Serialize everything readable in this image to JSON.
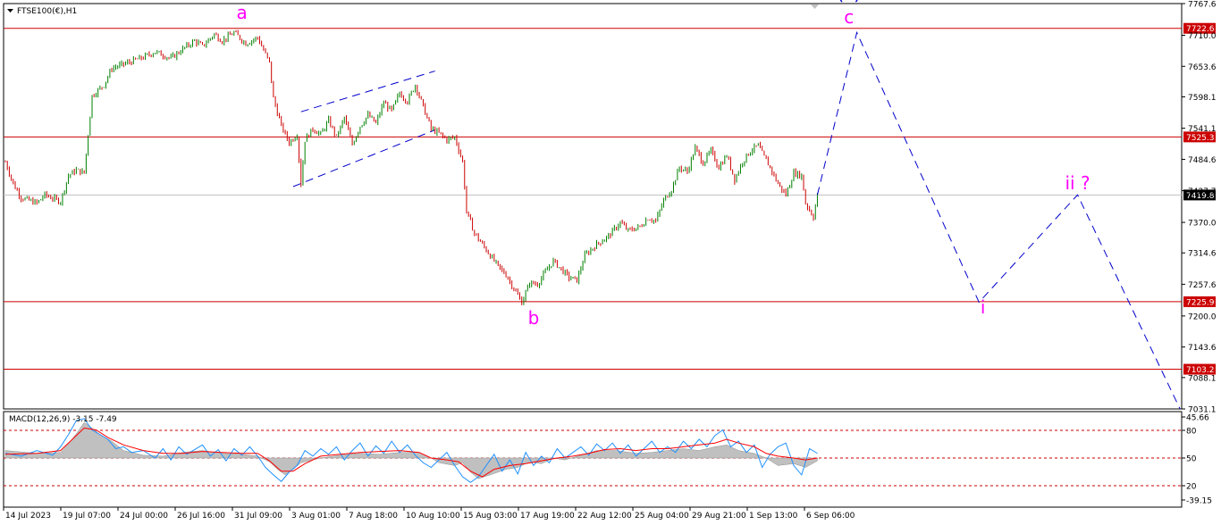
{
  "chart_data": [
    {
      "type": "candlestick",
      "symbol_label": "FTSE100(€),H1",
      "ylim": [
        7031.1,
        7767.6
      ],
      "y_ticks": [
        "7767.6",
        "7710.0",
        "7653.6",
        "7598.1",
        "7541.1",
        "7484.6",
        "7427.7",
        "7370.0",
        "7314.6",
        "7257.6",
        "7200.0",
        "7143.6",
        "7088.1",
        "7031.1"
      ],
      "x_ticks": [
        "14 Jul 2023",
        "19 Jul 07:00",
        "24 Jul 00:00",
        "26 Jul 16:00",
        "31 Jul 09:00",
        "3 Aug 01:00",
        "7 Aug 18:00",
        "10 Aug 10:00",
        "15 Aug 03:00",
        "17 Aug 19:00",
        "22 Aug 12:00",
        "25 Aug 04:00",
        "29 Aug 21:00",
        "1 Sep 13:00",
        "6 Sep 06:00"
      ],
      "current_price": "7419.8",
      "horizontal_levels": [
        {
          "value": 7722.6,
          "label": "7722.6"
        },
        {
          "value": 7525.3,
          "label": "7525.3"
        },
        {
          "value": 7225.9,
          "label": "7225.9"
        },
        {
          "value": 7103.2,
          "label": "7103.2"
        }
      ],
      "price_path": [
        [
          0,
          7480
        ],
        [
          2,
          7440
        ],
        [
          4,
          7415
        ],
        [
          8,
          7405
        ],
        [
          10,
          7420
        ],
        [
          14,
          7408
        ],
        [
          16,
          7455
        ],
        [
          18,
          7465
        ],
        [
          20,
          7460
        ],
        [
          21,
          7530
        ],
        [
          22,
          7600
        ],
        [
          25,
          7620
        ],
        [
          27,
          7650
        ],
        [
          31,
          7660
        ],
        [
          35,
          7670
        ],
        [
          38,
          7680
        ],
        [
          42,
          7668
        ],
        [
          45,
          7685
        ],
        [
          48,
          7700
        ],
        [
          50,
          7690
        ],
        [
          53,
          7712
        ],
        [
          55,
          7700
        ],
        [
          58,
          7715
        ],
        [
          61,
          7695
        ],
        [
          64,
          7706
        ],
        [
          67,
          7660
        ],
        [
          68,
          7595
        ],
        [
          70,
          7545
        ],
        [
          72,
          7515
        ],
        [
          74,
          7530
        ],
        [
          75,
          7440
        ],
        [
          76,
          7520
        ],
        [
          78,
          7540
        ],
        [
          80,
          7530
        ],
        [
          82,
          7555
        ],
        [
          84,
          7525
        ],
        [
          86,
          7560
        ],
        [
          88,
          7512
        ],
        [
          90,
          7545
        ],
        [
          92,
          7565
        ],
        [
          94,
          7550
        ],
        [
          96,
          7588
        ],
        [
          98,
          7572
        ],
        [
          100,
          7605
        ],
        [
          102,
          7590
        ],
        [
          104,
          7620
        ],
        [
          106,
          7580
        ],
        [
          108,
          7540
        ],
        [
          110,
          7532
        ],
        [
          112,
          7520
        ],
        [
          114,
          7525
        ],
        [
          116,
          7480
        ],
        [
          117,
          7390
        ],
        [
          119,
          7350
        ],
        [
          121,
          7330
        ],
        [
          123,
          7310
        ],
        [
          125,
          7290
        ],
        [
          127,
          7275
        ],
        [
          129,
          7250
        ],
        [
          131,
          7225
        ],
        [
          133,
          7260
        ],
        [
          135,
          7258
        ],
        [
          137,
          7280
        ],
        [
          139,
          7300
        ],
        [
          141,
          7285
        ],
        [
          143,
          7270
        ],
        [
          145,
          7265
        ],
        [
          147,
          7310
        ],
        [
          150,
          7330
        ],
        [
          153,
          7345
        ],
        [
          156,
          7370
        ],
        [
          158,
          7355
        ],
        [
          161,
          7362
        ],
        [
          163,
          7378
        ],
        [
          165,
          7372
        ],
        [
          167,
          7410
        ],
        [
          169,
          7430
        ],
        [
          171,
          7470
        ],
        [
          173,
          7462
        ],
        [
          175,
          7505
        ],
        [
          177,
          7478
        ],
        [
          179,
          7500
        ],
        [
          181,
          7470
        ],
        [
          183,
          7492
        ],
        [
          185,
          7448
        ],
        [
          187,
          7480
        ],
        [
          189,
          7500
        ],
        [
          191,
          7510
        ],
        [
          192,
          7495
        ],
        [
          194,
          7470
        ],
        [
          196,
          7440
        ],
        [
          198,
          7420
        ],
        [
          200,
          7460
        ],
        [
          202,
          7455
        ],
        [
          203,
          7405
        ],
        [
          205,
          7380
        ],
        [
          206,
          7420
        ]
      ],
      "projection_path": [
        [
          206,
          7420
        ],
        [
          216,
          7715
        ],
        [
          247,
          7225
        ],
        [
          272,
          7420
        ],
        [
          298,
          7031
        ]
      ],
      "channel_lines": [
        [
          [
            73,
            7435
          ],
          [
            109,
            7538
          ]
        ],
        [
          [
            75,
            7571
          ],
          [
            109,
            7645
          ]
        ]
      ],
      "wave_labels": [
        {
          "text": "a",
          "bar": 60,
          "price": 7740,
          "color": "#ff00ff"
        },
        {
          "text": "b",
          "bar": 134,
          "price": 7185,
          "color": "#ff00ff"
        },
        {
          "text": "(ii)",
          "bar": 214,
          "price": 7775,
          "color": "#0000cc"
        },
        {
          "text": "c",
          "bar": 214,
          "price": 7732,
          "color": "#ff00ff"
        },
        {
          "text": "i",
          "bar": 248,
          "price": 7205,
          "color": "#ff00ff"
        },
        {
          "text": "ii ?",
          "bar": 272,
          "price": 7430,
          "color": "#ff00ff"
        }
      ],
      "colors": {
        "bull": "#008000",
        "bear": "#cc0000",
        "level": "#cc0000",
        "projection": "#0000cc",
        "wave": "#ff00ff",
        "wave_degree": "#0000cc"
      }
    },
    {
      "type": "macd",
      "label": "MACD(12,26,9) -3.15 -7.49",
      "ylim": [
        -39.15,
        45.66
      ],
      "y_ticks": [
        "45.66",
        "80",
        "50",
        "20",
        "-39.15"
      ],
      "histogram_path": [
        [
          0,
          8
        ],
        [
          8,
          5
        ],
        [
          14,
          6
        ],
        [
          16,
          15
        ],
        [
          18,
          26
        ],
        [
          20,
          38
        ],
        [
          22,
          32
        ],
        [
          24,
          25
        ],
        [
          27,
          18
        ],
        [
          30,
          8
        ],
        [
          35,
          3
        ],
        [
          40,
          2
        ],
        [
          45,
          6
        ],
        [
          50,
          8
        ],
        [
          55,
          5
        ],
        [
          60,
          4
        ],
        [
          64,
          2
        ],
        [
          67,
          -4
        ],
        [
          69,
          -12
        ],
        [
          71,
          -18
        ],
        [
          73,
          -12
        ],
        [
          75,
          -5
        ],
        [
          80,
          0
        ],
        [
          85,
          3
        ],
        [
          90,
          5
        ],
        [
          95,
          4
        ],
        [
          100,
          6
        ],
        [
          105,
          6
        ],
        [
          108,
          0
        ],
        [
          110,
          -5
        ],
        [
          114,
          -8
        ],
        [
          116,
          -5
        ],
        [
          118,
          -15
        ],
        [
          120,
          -22
        ],
        [
          123,
          -18
        ],
        [
          127,
          -12
        ],
        [
          130,
          -10
        ],
        [
          133,
          -4
        ],
        [
          136,
          -6
        ],
        [
          139,
          0
        ],
        [
          142,
          -2
        ],
        [
          146,
          3
        ],
        [
          150,
          8
        ],
        [
          155,
          8
        ],
        [
          160,
          5
        ],
        [
          164,
          6
        ],
        [
          168,
          8
        ],
        [
          172,
          10
        ],
        [
          176,
          8
        ],
        [
          180,
          12
        ],
        [
          183,
          14
        ],
        [
          186,
          8
        ],
        [
          190,
          5
        ],
        [
          193,
          0
        ],
        [
          196,
          -8
        ],
        [
          200,
          -6
        ],
        [
          203,
          -10
        ],
        [
          206,
          -3
        ]
      ],
      "macd_path": [
        [
          0,
          5
        ],
        [
          4,
          2
        ],
        [
          8,
          8
        ],
        [
          12,
          3
        ],
        [
          14,
          12
        ],
        [
          16,
          25
        ],
        [
          18,
          40
        ],
        [
          20,
          42
        ],
        [
          22,
          30
        ],
        [
          24,
          25
        ],
        [
          26,
          20
        ],
        [
          28,
          10
        ],
        [
          30,
          12
        ],
        [
          32,
          6
        ],
        [
          35,
          8
        ],
        [
          38,
          0
        ],
        [
          40,
          10
        ],
        [
          42,
          -2
        ],
        [
          44,
          12
        ],
        [
          46,
          4
        ],
        [
          48,
          9
        ],
        [
          50,
          14
        ],
        [
          52,
          2
        ],
        [
          54,
          9
        ],
        [
          56,
          -3
        ],
        [
          58,
          10
        ],
        [
          60,
          3
        ],
        [
          62,
          12
        ],
        [
          64,
          2
        ],
        [
          66,
          -10
        ],
        [
          68,
          -18
        ],
        [
          70,
          -25
        ],
        [
          72,
          -15
        ],
        [
          74,
          -8
        ],
        [
          76,
          8
        ],
        [
          78,
          2
        ],
        [
          80,
          10
        ],
        [
          82,
          4
        ],
        [
          84,
          12
        ],
        [
          86,
          -2
        ],
        [
          88,
          8
        ],
        [
          90,
          16
        ],
        [
          92,
          2
        ],
        [
          94,
          13
        ],
        [
          96,
          5
        ],
        [
          98,
          18
        ],
        [
          100,
          6
        ],
        [
          102,
          14
        ],
        [
          104,
          3
        ],
        [
          106,
          -5
        ],
        [
          108,
          -10
        ],
        [
          110,
          -2
        ],
        [
          112,
          6
        ],
        [
          114,
          -8
        ],
        [
          116,
          -20
        ],
        [
          118,
          -26
        ],
        [
          120,
          -20
        ],
        [
          122,
          -8
        ],
        [
          124,
          4
        ],
        [
          126,
          -14
        ],
        [
          128,
          -2
        ],
        [
          130,
          -17
        ],
        [
          132,
          6
        ],
        [
          134,
          -8
        ],
        [
          136,
          2
        ],
        [
          138,
          -5
        ],
        [
          140,
          10
        ],
        [
          142,
          0
        ],
        [
          144,
          6
        ],
        [
          146,
          12
        ],
        [
          148,
          3
        ],
        [
          150,
          15
        ],
        [
          152,
          8
        ],
        [
          154,
          16
        ],
        [
          156,
          5
        ],
        [
          158,
          14
        ],
        [
          160,
          2
        ],
        [
          162,
          10
        ],
        [
          164,
          18
        ],
        [
          166,
          6
        ],
        [
          168,
          12
        ],
        [
          170,
          6
        ],
        [
          172,
          18
        ],
        [
          174,
          10
        ],
        [
          176,
          20
        ],
        [
          178,
          12
        ],
        [
          180,
          24
        ],
        [
          182,
          30
        ],
        [
          184,
          12
        ],
        [
          186,
          18
        ],
        [
          188,
          6
        ],
        [
          190,
          14
        ],
        [
          192,
          -10
        ],
        [
          194,
          4
        ],
        [
          196,
          12
        ],
        [
          198,
          16
        ],
        [
          200,
          -8
        ],
        [
          202,
          -18
        ],
        [
          204,
          10
        ],
        [
          206,
          5
        ]
      ],
      "signal_path": [
        [
          0,
          4
        ],
        [
          8,
          5
        ],
        [
          14,
          8
        ],
        [
          17,
          20
        ],
        [
          20,
          32
        ],
        [
          23,
          30
        ],
        [
          26,
          22
        ],
        [
          30,
          14
        ],
        [
          35,
          8
        ],
        [
          40,
          5
        ],
        [
          45,
          5
        ],
        [
          50,
          7
        ],
        [
          55,
          6
        ],
        [
          60,
          5
        ],
        [
          64,
          5
        ],
        [
          67,
          -3
        ],
        [
          70,
          -14
        ],
        [
          73,
          -14
        ],
        [
          76,
          -6
        ],
        [
          80,
          2
        ],
        [
          85,
          4
        ],
        [
          90,
          6
        ],
        [
          95,
          7
        ],
        [
          100,
          8
        ],
        [
          105,
          6
        ],
        [
          108,
          0
        ],
        [
          112,
          -2
        ],
        [
          115,
          -4
        ],
        [
          118,
          -14
        ],
        [
          121,
          -20
        ],
        [
          124,
          -12
        ],
        [
          128,
          -8
        ],
        [
          132,
          -6
        ],
        [
          136,
          -3
        ],
        [
          140,
          0
        ],
        [
          144,
          2
        ],
        [
          148,
          5
        ],
        [
          152,
          9
        ],
        [
          156,
          10
        ],
        [
          160,
          8
        ],
        [
          164,
          10
        ],
        [
          168,
          10
        ],
        [
          172,
          12
        ],
        [
          176,
          14
        ],
        [
          180,
          16
        ],
        [
          183,
          20
        ],
        [
          186,
          16
        ],
        [
          190,
          12
        ],
        [
          193,
          5
        ],
        [
          196,
          2
        ],
        [
          200,
          0
        ],
        [
          203,
          -2
        ],
        [
          206,
          0
        ]
      ],
      "colors": {
        "histogram": "#c0c0c0",
        "macd": "#1e90ff",
        "signal": "#ff0000"
      }
    }
  ]
}
